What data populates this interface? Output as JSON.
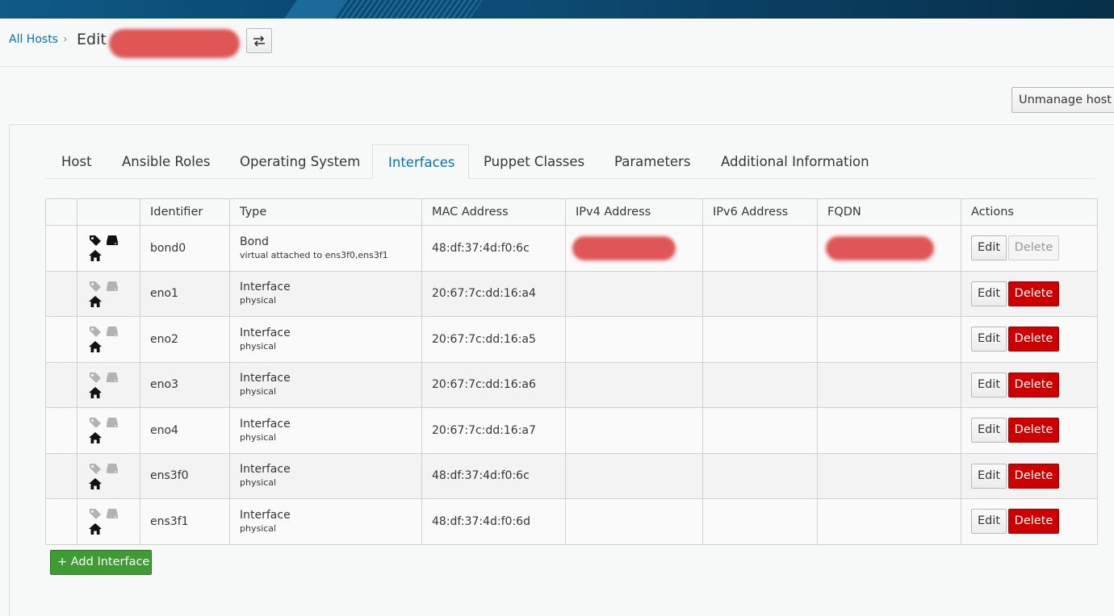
{
  "colors": {
    "link": "#0074b3",
    "danger": "#cc0000",
    "success": "#3f9c35",
    "header": "#0a4a72"
  },
  "breadcrumb": {
    "root": "All Hosts",
    "separator": "›",
    "title": "Edit"
  },
  "header": {
    "switch_icon": "swap-arrows-icon",
    "unmanage_label": "Unmanage host"
  },
  "tabs": [
    {
      "label": "Host"
    },
    {
      "label": "Ansible Roles"
    },
    {
      "label": "Operating System"
    },
    {
      "label": "Interfaces",
      "active": true
    },
    {
      "label": "Puppet Classes"
    },
    {
      "label": "Parameters"
    },
    {
      "label": "Additional Information"
    }
  ],
  "table": {
    "columns": [
      "Identifier",
      "Type",
      "MAC Address",
      "IPv4 Address",
      "IPv6 Address",
      "FQDN",
      "Actions"
    ],
    "edit_label": "Edit",
    "delete_label": "Delete",
    "rows": [
      {
        "identifier": "bond0",
        "type": "Bond",
        "subtype": "virtual attached to ens3f0,ens3f1",
        "mac": "48:df:37:4d:f0:6c",
        "primary": true,
        "provision": true,
        "managed": true,
        "delete_enabled": false
      },
      {
        "identifier": "eno1",
        "type": "Interface",
        "subtype": "physical",
        "mac": "20:67:7c:dd:16:a4",
        "primary": false,
        "provision": false,
        "managed": true,
        "delete_enabled": true
      },
      {
        "identifier": "eno2",
        "type": "Interface",
        "subtype": "physical",
        "mac": "20:67:7c:dd:16:a5",
        "primary": false,
        "provision": false,
        "managed": true,
        "delete_enabled": true
      },
      {
        "identifier": "eno3",
        "type": "Interface",
        "subtype": "physical",
        "mac": "20:67:7c:dd:16:a6",
        "primary": false,
        "provision": false,
        "managed": true,
        "delete_enabled": true
      },
      {
        "identifier": "eno4",
        "type": "Interface",
        "subtype": "physical",
        "mac": "20:67:7c:dd:16:a7",
        "primary": false,
        "provision": false,
        "managed": true,
        "delete_enabled": true
      },
      {
        "identifier": "ens3f0",
        "type": "Interface",
        "subtype": "physical",
        "mac": "48:df:37:4d:f0:6c",
        "primary": false,
        "provision": false,
        "managed": true,
        "delete_enabled": true
      },
      {
        "identifier": "ens3f1",
        "type": "Interface",
        "subtype": "physical",
        "mac": "48:df:37:4d:f0:6d",
        "primary": false,
        "provision": false,
        "managed": true,
        "delete_enabled": true
      }
    ]
  },
  "add_interface_label": "+ Add Interface"
}
